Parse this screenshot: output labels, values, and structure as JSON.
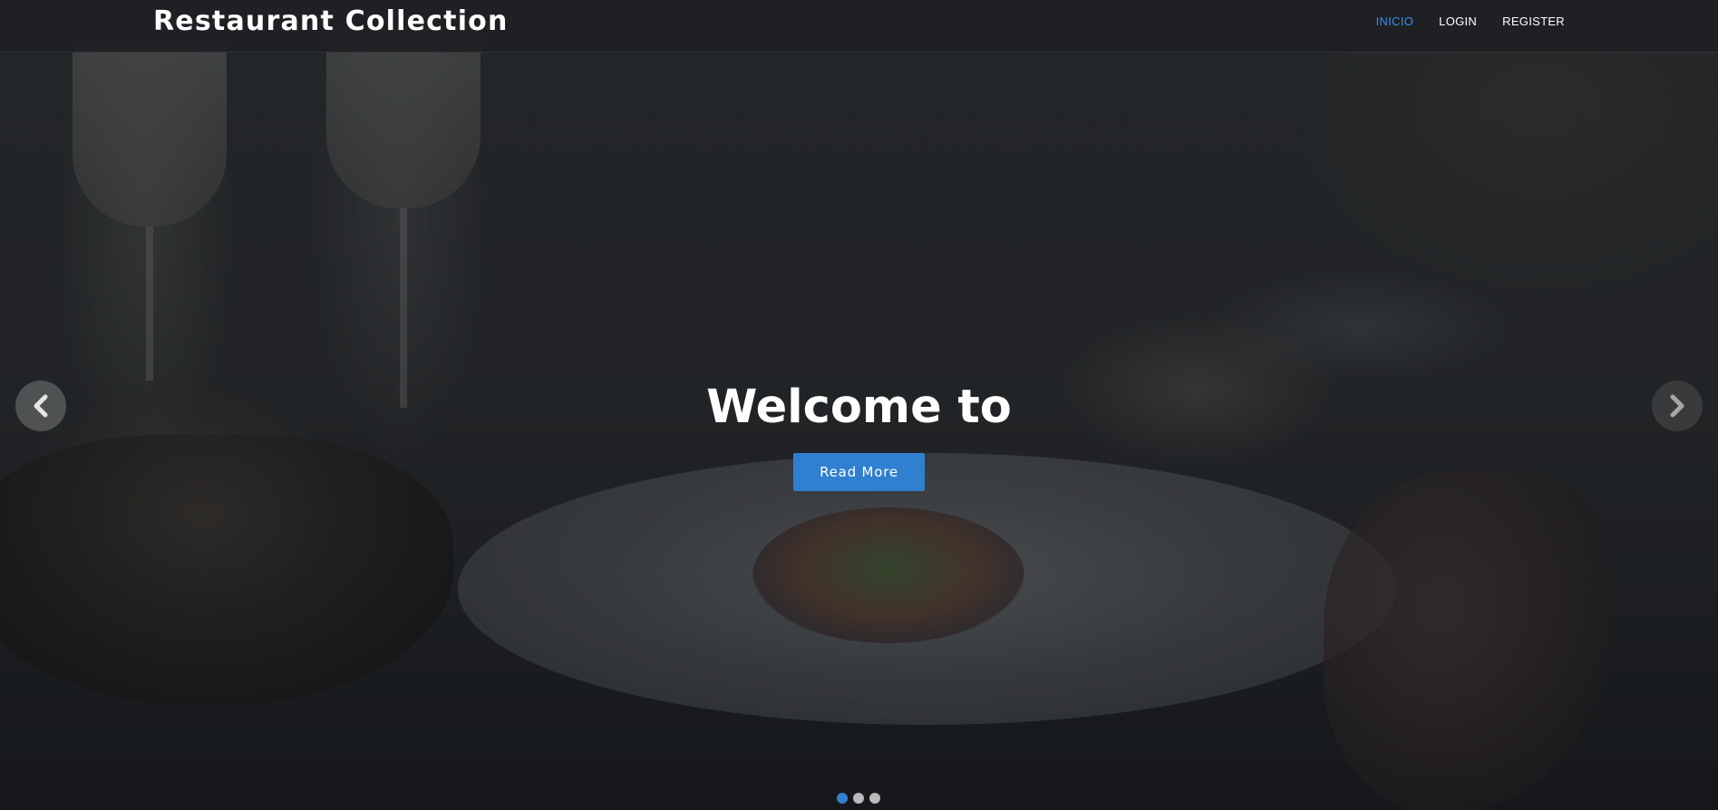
{
  "app": {
    "brand": "Restaurant Collection"
  },
  "nav": {
    "items": [
      {
        "label": "INICIO",
        "active": true
      },
      {
        "label": "LOGIN",
        "active": false
      },
      {
        "label": "REGISTER",
        "active": false
      }
    ]
  },
  "hero": {
    "title": "Welcome to",
    "button_label": "Read More",
    "prev_icon": "chevron-left-icon",
    "next_icon": "chevron-right-icon"
  },
  "carousel": {
    "slide_count": 3,
    "active_index": 0
  },
  "colors": {
    "accent": "#2f80d1",
    "nav_active": "#3a8ee6",
    "navbar_bg": "#1e2024",
    "text": "#ffffff",
    "dot_inactive": "#b9b9b9"
  }
}
